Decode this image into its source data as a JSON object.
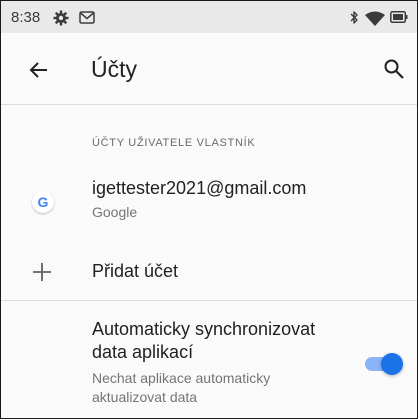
{
  "status_bar": {
    "time": "8:38",
    "icons": [
      "settings-gear-icon",
      "gmail-icon",
      "bluetooth-icon",
      "wifi-icon",
      "battery-icon"
    ]
  },
  "app_bar": {
    "title": "Účty",
    "back_icon": "arrow-back-icon",
    "search_icon": "search-icon"
  },
  "section": {
    "header": "ÚČTY UŽIVATELE VLASTNÍK"
  },
  "account": {
    "email": "igettester2021@gmail.com",
    "provider": "Google",
    "icon_letter": "G",
    "icon": "google-icon"
  },
  "add_account": {
    "label": "Přidat účet",
    "icon": "plus-icon"
  },
  "sync_setting": {
    "title": "Automaticky synchronizovat data aplikací",
    "summary": "Nechat aplikace automaticky aktualizovat data",
    "enabled": true
  },
  "colors": {
    "accent": "#1a73e8",
    "toggle_track": "#8ab4f8",
    "status_bar_bg": "#e9e9e9",
    "background": "#fafafa",
    "primary_text": "#202124",
    "secondary_text": "#757575"
  }
}
